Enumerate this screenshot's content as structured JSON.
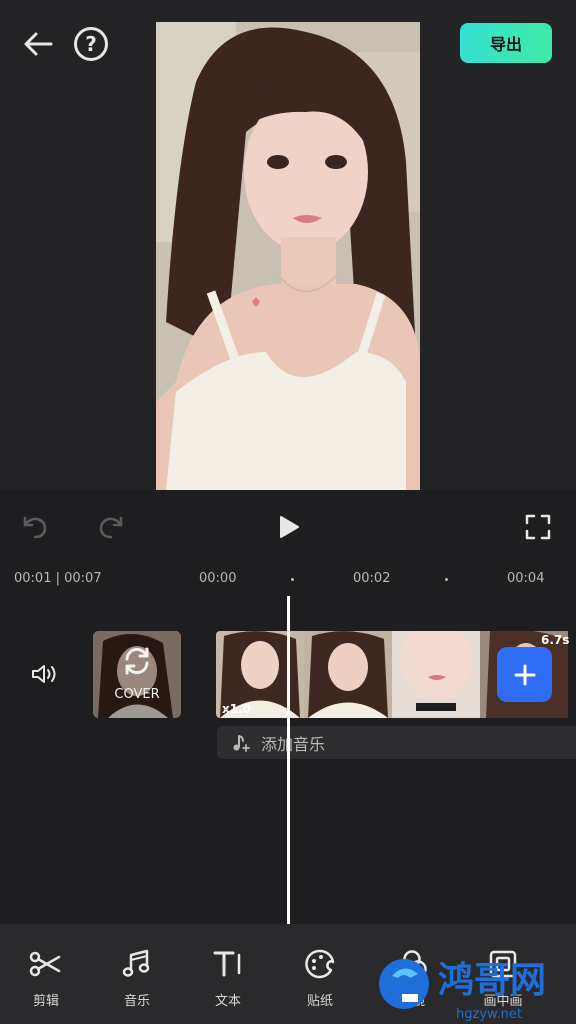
{
  "header": {
    "export_label": "导出"
  },
  "playback": {
    "current_time": "00:01",
    "total_time": "00:07"
  },
  "timeline": {
    "ruler": [
      "00:00",
      "00:02",
      "00:04"
    ],
    "cover_label": "COVER",
    "speed": "x1.0",
    "duration": "6.7s",
    "add_music_label": "添加音乐"
  },
  "toolbar": {
    "items": [
      {
        "label": "剪辑",
        "icon": "scissors-icon"
      },
      {
        "label": "音乐",
        "icon": "music-note-icon"
      },
      {
        "label": "文本",
        "icon": "text-icon"
      },
      {
        "label": "贴纸",
        "icon": "sticker-icon"
      },
      {
        "label": "滤镜",
        "icon": "filter-icon"
      },
      {
        "label": "画中画",
        "icon": "picture-in-picture-icon"
      }
    ]
  },
  "watermark": {
    "brand": "鸿哥网",
    "url": "hgzyw.net"
  },
  "colors": {
    "accent_export": "#35e0d0",
    "accent_add": "#2f6df6",
    "background": "#232325"
  }
}
